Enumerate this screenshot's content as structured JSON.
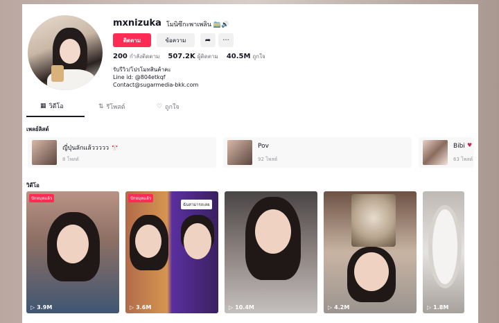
{
  "profile": {
    "username": "mxnizuka",
    "nickname": "โมนิซึกะพาเพลิน 🚞🔊",
    "follow_label": "ติดตาม",
    "message_label": "ข้อความ",
    "stats": [
      {
        "value": "200",
        "label": "กำลังติดตาม"
      },
      {
        "value": "507.2K",
        "label": "ผู้ติดตาม"
      },
      {
        "value": "40.5M",
        "label": "ถูกใจ"
      }
    ],
    "bio": [
      "รับรีวิว/โปรโมทสินค้าคะ",
      "Line id: @804etkqf",
      "Contact@sugarmedia-bkk.com"
    ]
  },
  "tabs": [
    {
      "label": "วิดีโอ",
      "icon": "grid-icon"
    },
    {
      "label": "รีโพสต์",
      "icon": "repost-icon"
    },
    {
      "label": "ถูกใจ",
      "icon": "heart-outline-icon"
    }
  ],
  "playlists": {
    "heading": "เพลย์ลิสต์",
    "items": [
      {
        "name": "ญี่ปุ่นลักแล้ววววว 🎌",
        "count": "8 โพสต์"
      },
      {
        "name": "Pov",
        "count": "92 โพสต์"
      },
      {
        "name": "Bibi",
        "count": "63 โพสต์"
      }
    ]
  },
  "videos": {
    "heading": "วิดีโอ",
    "items": [
      {
        "views": "3.9M",
        "tag": "ปักหมุดแล้ว"
      },
      {
        "views": "3.6M",
        "tag": "ปักหมุดแล้ว",
        "overlay": "ฉันสามารถเลย"
      },
      {
        "views": "10.4M"
      },
      {
        "views": "4.2M"
      },
      {
        "views": "1.8M"
      }
    ]
  }
}
